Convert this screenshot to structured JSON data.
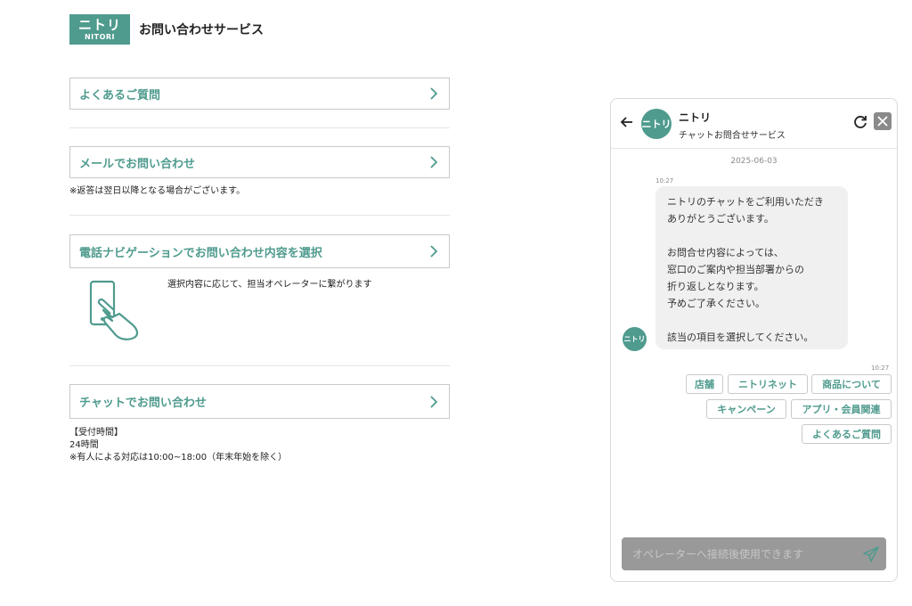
{
  "header": {
    "logo_kana": "ニトリ",
    "logo_en": "NITORI",
    "title": "お問い合わせサービス"
  },
  "menu": {
    "faq_label": "よくあるご質問",
    "mail_label": "メールでお問い合わせ",
    "mail_note": "※返答は翌日以降となる場合がございます。",
    "phone_label": "電話ナビゲーションでお問い合わせ内容を選択",
    "phone_caption": "選択内容に応じて、担当オペレーターに繋がります",
    "chat_label": "チャットでお問い合わせ",
    "hours_title": "【受付時間】",
    "hours_value": "24時間",
    "hours_note": "※有人による対応は10:00~18:00（年末年始を除く）"
  },
  "chat": {
    "avatar_text": "ニトリ",
    "name": "ニトリ",
    "subtitle": "チャットお問合せサービス",
    "date": "2025-06-03",
    "bot_time": "10:27",
    "bot_message": "ニトリのチャットをご利用いただき\nありがとうございます。\n\nお問合せ内容によっては、\n窓口のご案内や担当部署からの\n折り返しとなります。\n予めご了承ください。\n\n該当の項目を選択してください。",
    "choices_time": "10:27",
    "choices": [
      "店舗",
      "ニトリネット",
      "商品について",
      "キャンペーン",
      "アプリ・会員関連",
      "よくあるご質問"
    ],
    "input_placeholder": "オペレーターへ接続後使用できます"
  },
  "colors": {
    "brand": "#4f9b8e",
    "input_bg": "#999999"
  }
}
